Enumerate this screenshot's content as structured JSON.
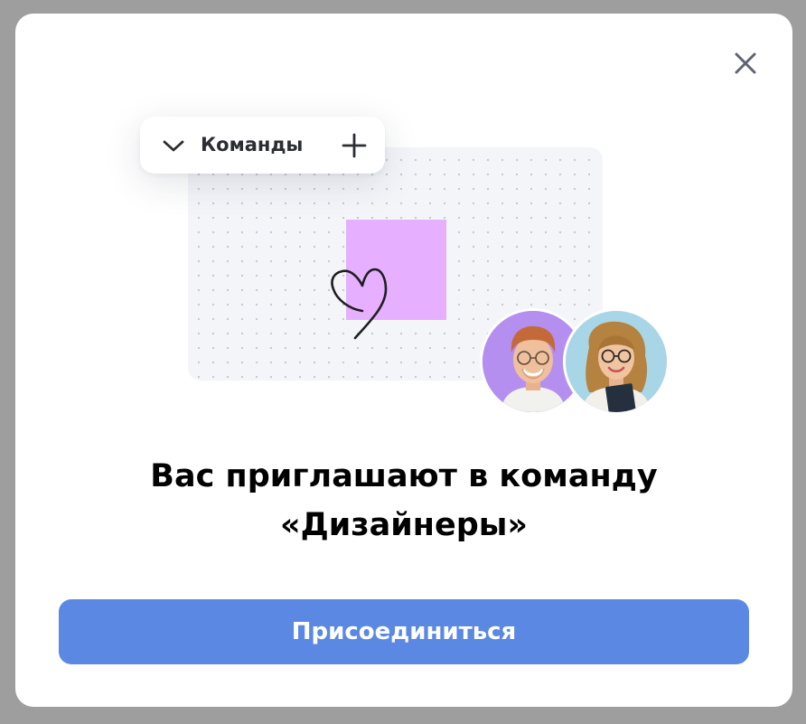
{
  "dialog": {
    "close_icon": "close-icon",
    "illustration": {
      "teams_dropdown": {
        "label": "Команды",
        "chevron_icon": "chevron-down-icon",
        "add_icon": "plus-icon"
      },
      "board": {
        "sticky_color": "#e6afff",
        "doodle_icon": "heart-icon"
      },
      "avatars": [
        {
          "icon": "avatar-man",
          "background": "#b58ff0"
        },
        {
          "icon": "avatar-woman",
          "background": "#a9d6e6"
        }
      ]
    },
    "title_line1": "Вас приглашают в команду",
    "title_line2": "«Дизайнеры»",
    "join_button_label": "Присоединиться",
    "accent_color": "#5b88e2"
  }
}
